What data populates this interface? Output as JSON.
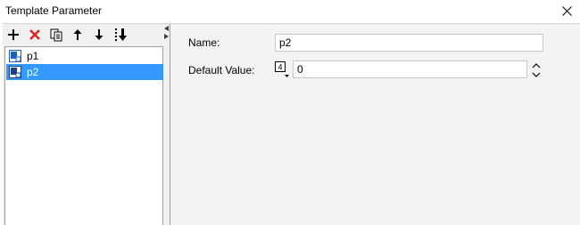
{
  "window": {
    "title": "Template Parameter",
    "close_icon": "close-icon"
  },
  "toolbar": {
    "buttons": [
      {
        "name": "add-icon",
        "color": "#000000"
      },
      {
        "name": "delete-icon",
        "color": "#e0201b"
      },
      {
        "name": "copy-icon",
        "color": "#000000"
      },
      {
        "name": "move-up-icon",
        "color": "#000000"
      },
      {
        "name": "move-down-icon",
        "color": "#000000"
      },
      {
        "name": "sort-icon",
        "color": "#000000"
      }
    ]
  },
  "parameters": {
    "items": [
      {
        "label": "p1",
        "selected": false
      },
      {
        "label": "p2",
        "selected": true
      }
    ]
  },
  "form": {
    "name_label": "Name:",
    "name_value": "p2",
    "default_label": "Default Value:",
    "default_value": "0",
    "type_badge": "4"
  },
  "colors": {
    "selection": "#3399ff",
    "panel_bg": "#f3f3f4",
    "delete": "#e0201b"
  }
}
